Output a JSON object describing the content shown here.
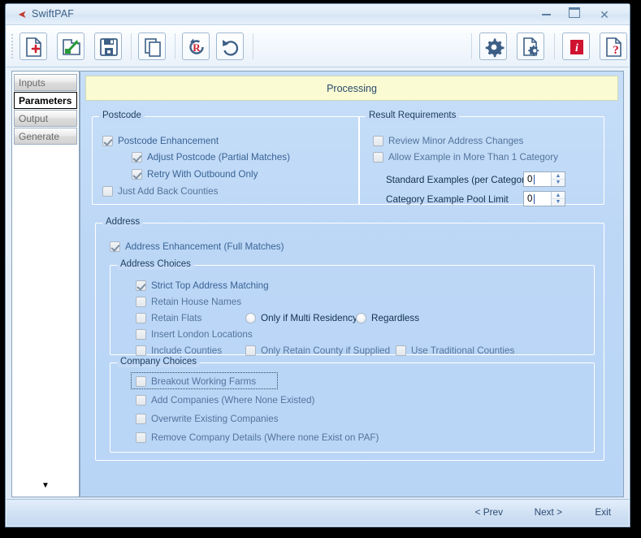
{
  "window": {
    "title": "SwiftPAF",
    "logo_icon": "swift-arrow-logo",
    "controls": {
      "minimize": "minimize-icon",
      "maximize": "maximize-icon",
      "close": "close-icon"
    }
  },
  "toolbar": {
    "buttons": [
      {
        "name": "new-file-button",
        "icon": "page-plus-icon"
      },
      {
        "name": "open-file-button",
        "icon": "folder-open-icon"
      },
      {
        "name": "save-file-button",
        "icon": "floppy-disk-icon"
      },
      {
        "name": "copy-button",
        "icon": "copy-pages-icon"
      },
      {
        "name": "reset-button",
        "icon": "reset-r-icon"
      },
      {
        "name": "undo-button",
        "icon": "undo-arrow-icon"
      },
      {
        "name": "settings-button",
        "icon": "gear-icon"
      },
      {
        "name": "document-settings-button",
        "icon": "page-gear-icon"
      },
      {
        "name": "info-button",
        "icon": "info-i-icon"
      },
      {
        "name": "help-button",
        "icon": "page-question-icon"
      }
    ]
  },
  "sidebar": {
    "items": [
      {
        "label": "Inputs",
        "selected": false
      },
      {
        "label": "Parameters",
        "selected": true
      },
      {
        "label": "Output",
        "selected": false
      },
      {
        "label": "Generate",
        "selected": false
      }
    ],
    "scroll_down_icon": "chevron-down-icon"
  },
  "banner": {
    "title": "Processing"
  },
  "postcode_group": {
    "legend": "Postcode",
    "options": [
      {
        "label": "Postcode Enhancement",
        "checked": true
      },
      {
        "label": "Adjust Postcode (Partial Matches)",
        "checked": true
      },
      {
        "label": "Retry With Outbound Only",
        "checked": true
      },
      {
        "label": "Just Add Back Counties",
        "checked": false
      }
    ]
  },
  "result_requirements_group": {
    "legend": "Result Requirements",
    "options": [
      {
        "label": "Review Minor Address Changes",
        "checked": false
      },
      {
        "label": "Allow Example in More Than 1 Category",
        "checked": false
      }
    ],
    "fields": [
      {
        "label": "Standard Examples (per Category)",
        "value": "0"
      },
      {
        "label": "Category Example Pool Limit",
        "value": "0"
      }
    ]
  },
  "address_group": {
    "legend": "Address",
    "enhancement": {
      "label": "Address Enhancement (Full Matches)",
      "checked": true
    },
    "address_choices": {
      "legend": "Address Choices",
      "options": [
        {
          "label": "Strict Top Address Matching",
          "checked": true
        },
        {
          "label": "Retain House Names",
          "checked": false
        },
        {
          "label": "Retain Flats",
          "checked": false
        },
        {
          "label": "Insert London Locations",
          "checked": false
        },
        {
          "label": "Include Counties",
          "checked": false
        }
      ],
      "radios": [
        {
          "label": "Only if Multi Residency",
          "selected": false
        },
        {
          "label": "Regardless",
          "selected": false
        }
      ],
      "extra_options": [
        {
          "label": "Only Retain County if Supplied",
          "checked": false
        },
        {
          "label": "Use Traditional Counties",
          "checked": false
        }
      ]
    },
    "company_choices": {
      "legend": "Company Choices",
      "options": [
        {
          "label": "Breakout Working Farms",
          "checked": false,
          "focused": true
        },
        {
          "label": "Add Companies (Where None Existed)",
          "checked": false
        },
        {
          "label": "Overwrite Existing Companies",
          "checked": false
        },
        {
          "label": "Remove Company Details (Where none Exist on PAF)",
          "checked": false
        }
      ]
    }
  },
  "footer": {
    "prev_label": "< Prev",
    "next_label": "Next >",
    "exit_label": "Exit"
  },
  "colors": {
    "panel_background": "#bcd7f6",
    "banner_background": "#fafbd2",
    "accent_text": "#3a6395",
    "title_text": "#3a5f86"
  }
}
